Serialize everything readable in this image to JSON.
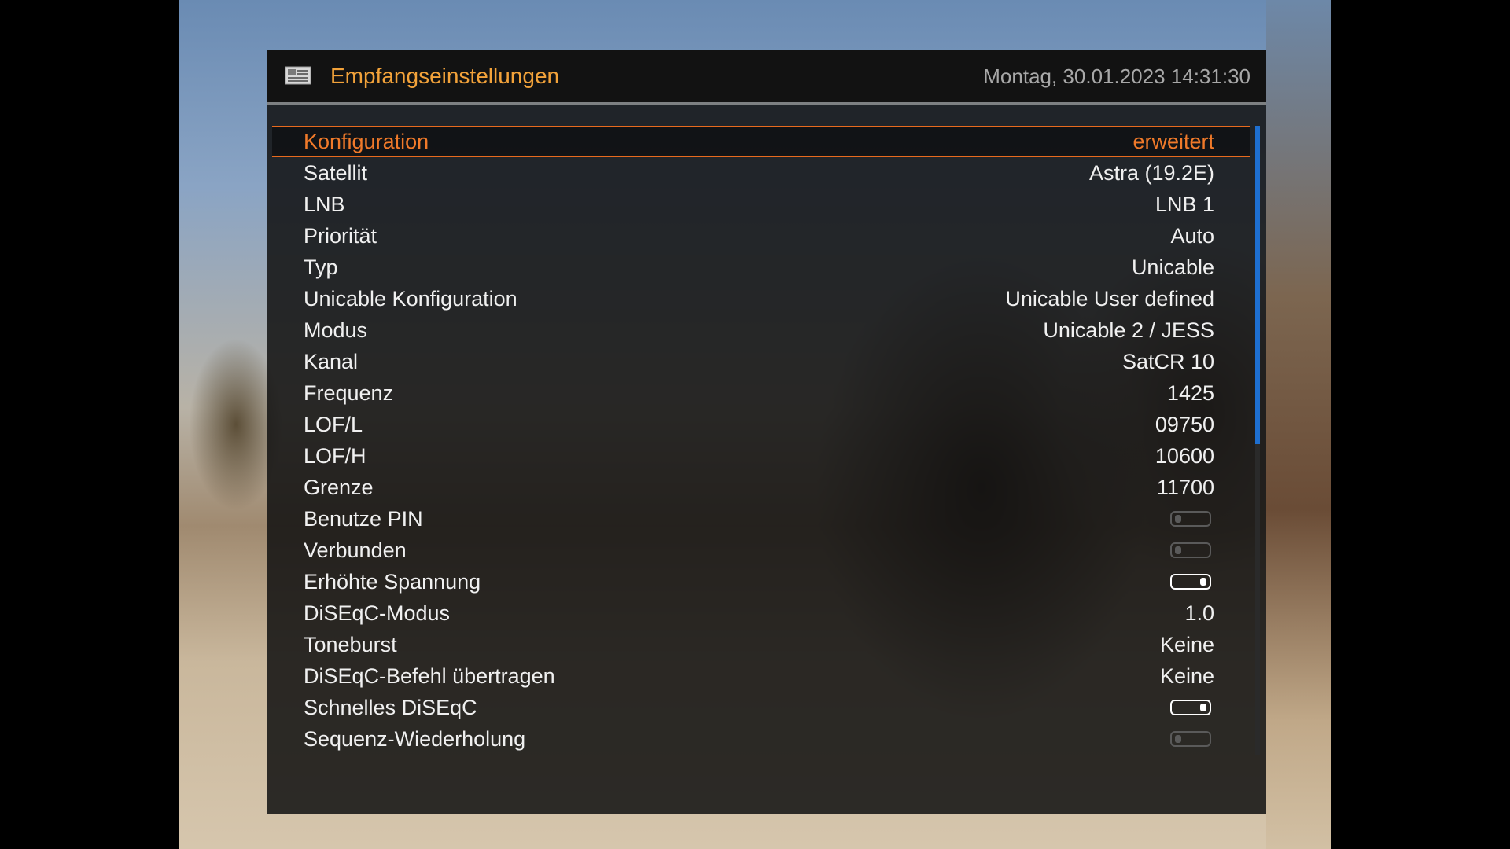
{
  "header": {
    "title": "Empfangseinstellungen",
    "datetime": "Montag, 30.01.2023  14:31:30",
    "icon": "settings-screen-icon"
  },
  "colors": {
    "accent": "#f07a2a",
    "title": "#f2a23a",
    "scrollbar": "#1e6fd0"
  },
  "settings": [
    {
      "label": "Konfiguration",
      "value": "erweitert",
      "selected": true
    },
    {
      "label": "Satellit",
      "value": "Astra (19.2E)"
    },
    {
      "label": "LNB",
      "value": "LNB 1"
    },
    {
      "label": "Priorität",
      "value": "Auto"
    },
    {
      "label": "Typ",
      "value": "Unicable"
    },
    {
      "label": "Unicable Konfiguration",
      "value": "Unicable User defined"
    },
    {
      "label": "Modus",
      "value": "Unicable 2 / JESS"
    },
    {
      "label": "Kanal",
      "value": "SatCR 10"
    },
    {
      "label": "Frequenz",
      "value": "1425"
    },
    {
      "label": "LOF/L",
      "value": "09750"
    },
    {
      "label": "LOF/H",
      "value": "10600"
    },
    {
      "label": "Grenze",
      "value": "11700"
    },
    {
      "label": "Benutze PIN",
      "toggle": "off"
    },
    {
      "label": "Verbunden",
      "toggle": "off"
    },
    {
      "label": "Erhöhte Spannung",
      "toggle": "on"
    },
    {
      "label": "DiSEqC-Modus",
      "value": "1.0"
    },
    {
      "label": "Toneburst",
      "value": "Keine"
    },
    {
      "label": "DiSEqC-Befehl übertragen",
      "value": "Keine"
    },
    {
      "label": "Schnelles DiSEqC",
      "toggle": "on"
    },
    {
      "label": "Sequenz-Wiederholung",
      "toggle": "off"
    }
  ]
}
